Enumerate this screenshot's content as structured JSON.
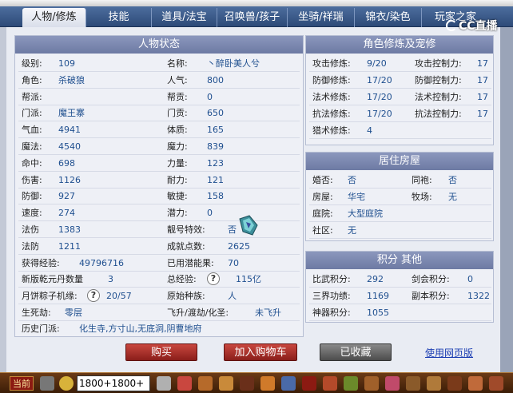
{
  "tabs": [
    {
      "label": "人物/修炼"
    },
    {
      "label": "技能"
    },
    {
      "label": "道具/法宝"
    },
    {
      "label": "召唤兽/孩子"
    },
    {
      "label": "坐骑/祥瑞"
    },
    {
      "label": "锦衣/染色"
    },
    {
      "label": "玩家之家"
    }
  ],
  "logo": {
    "text": "CC直播"
  },
  "status": {
    "title": "人物状态",
    "left": [
      {
        "label": "级别:",
        "value": "109"
      },
      {
        "label": "角色:",
        "value": "杀破狼"
      },
      {
        "label": "帮派:",
        "value": ""
      },
      {
        "label": "门派:",
        "value": "魔王寨"
      },
      {
        "label": "气血:",
        "value": "4941"
      },
      {
        "label": "魔法:",
        "value": "4540"
      },
      {
        "label": "命中:",
        "value": "698"
      },
      {
        "label": "伤害:",
        "value": "1126"
      },
      {
        "label": "防御:",
        "value": "927"
      },
      {
        "label": "速度:",
        "value": "274"
      },
      {
        "label": "法伤",
        "value": "1383"
      },
      {
        "label": "法防",
        "value": "1211"
      },
      {
        "label": "获得经验:",
        "value": "49796716"
      },
      {
        "label": "新版乾元丹数量",
        "value": "3"
      },
      {
        "label": "月饼粽子机缘:",
        "value": "20/57"
      },
      {
        "label": "生死劫:",
        "value": "零层"
      }
    ],
    "right": [
      {
        "label": "名称:",
        "value": "丶醉卧美人兮"
      },
      {
        "label": "人气:",
        "value": "800"
      },
      {
        "label": "帮贡:",
        "value": "0"
      },
      {
        "label": "门贡:",
        "value": "650"
      },
      {
        "label": "体质:",
        "value": "165"
      },
      {
        "label": "魔力:",
        "value": "839"
      },
      {
        "label": "力量:",
        "value": "123"
      },
      {
        "label": "耐力:",
        "value": "121"
      },
      {
        "label": "敏捷:",
        "value": "158"
      },
      {
        "label": "潜力:",
        "value": "0"
      },
      {
        "label": "靓号特效:",
        "value": "否"
      },
      {
        "label": "成就点数:",
        "value": "2625"
      },
      {
        "label": "已用潜能果:",
        "value": "70"
      },
      {
        "label": "总经验:",
        "value": "115亿"
      },
      {
        "label": "原始种族:",
        "value": "人"
      },
      {
        "label": "飞升/渡劫/化圣:",
        "value": "未飞升"
      }
    ],
    "history_label": "历史门派:",
    "history_value": "化生寺,方寸山,无底洞,阴曹地府"
  },
  "cultivation": {
    "title": "角色修炼及宠修",
    "rows": [
      {
        "l1": "攻击修炼:",
        "v1": "9/20",
        "l2": "攻击控制力:",
        "v2": "17"
      },
      {
        "l1": "防御修炼:",
        "v1": "17/20",
        "l2": "防御控制力:",
        "v2": "17"
      },
      {
        "l1": "法术修炼:",
        "v1": "17/20",
        "l2": "法术控制力:",
        "v2": "17"
      },
      {
        "l1": "抗法修炼:",
        "v1": "17/20",
        "l2": "抗法控制力:",
        "v2": "17"
      },
      {
        "l1": "猎术修炼:",
        "v1": "4",
        "l2": "",
        "v2": ""
      }
    ]
  },
  "housing": {
    "title": "居住房屋",
    "rows": [
      {
        "l1": "婚否:",
        "v1": "否",
        "l2": "同袍:",
        "v2": "否"
      },
      {
        "l1": "房屋:",
        "v1": "华宅",
        "l2": "牧场:",
        "v2": "无"
      },
      {
        "l1": "庭院:",
        "v1": "大型庭院",
        "l2": "",
        "v2": ""
      },
      {
        "l1": "社区:",
        "v1": "无",
        "l2": "",
        "v2": ""
      }
    ]
  },
  "score": {
    "title": "积分 其他",
    "rows": [
      {
        "l1": "比武积分:",
        "v1": "292",
        "l2": "剑会积分:",
        "v2": "0"
      },
      {
        "l1": "三界功绩:",
        "v1": "1169",
        "l2": "副本积分:",
        "v2": "1322"
      },
      {
        "l1": "神器积分:",
        "v1": "1055",
        "l2": "",
        "v2": ""
      }
    ]
  },
  "actions": {
    "buy": "购买",
    "add_cart": "加入购物车",
    "collected": "已收藏",
    "web_version": "使用网页版"
  },
  "taskbar": {
    "current": "当前",
    "input_value": "1800+1800+"
  },
  "colors": {
    "accent_red": "#8a1e1a",
    "value_blue": "#1f4f8f",
    "header": "#6d7aa3"
  }
}
